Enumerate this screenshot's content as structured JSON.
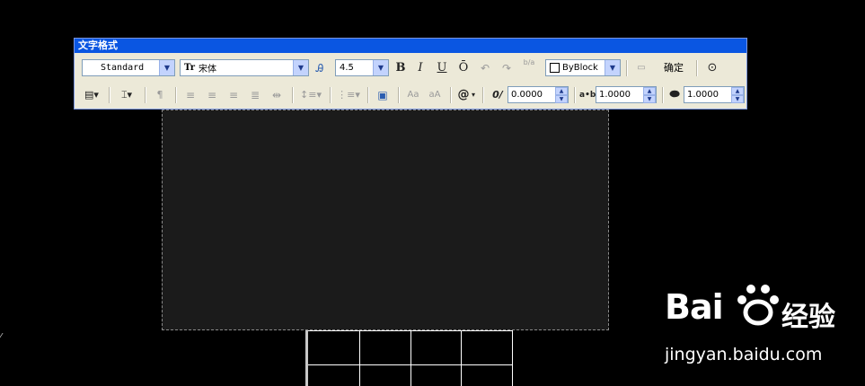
{
  "window": {
    "title": "文字格式"
  },
  "toolbar1": {
    "style_value": "Standard",
    "font_value": "宋体",
    "font_icon": "Tr",
    "height_value": "4.5",
    "bold": "B",
    "italic": "I",
    "underline": "U",
    "overline": "Ō",
    "stack_icon": "b/a",
    "color_value": "ByBlock",
    "ok_label": "确定"
  },
  "toolbar2": {
    "oblique_value": "0.0000",
    "tracking_value": "1.0000",
    "width_value": "1.0000",
    "upper_label": "Aa",
    "lower_label": "aA",
    "symbol_label": "@",
    "oblique_icon": "0/",
    "tracking_icon": "a•b"
  },
  "watermark": {
    "logo": "Bai",
    "logo2": "经验",
    "url": "jingyan.baidu.com"
  },
  "colors": {
    "titlebar": "#0a56e2",
    "toolbar_bg": "#ece9d8",
    "editor_bg": "#1b1b1b"
  }
}
